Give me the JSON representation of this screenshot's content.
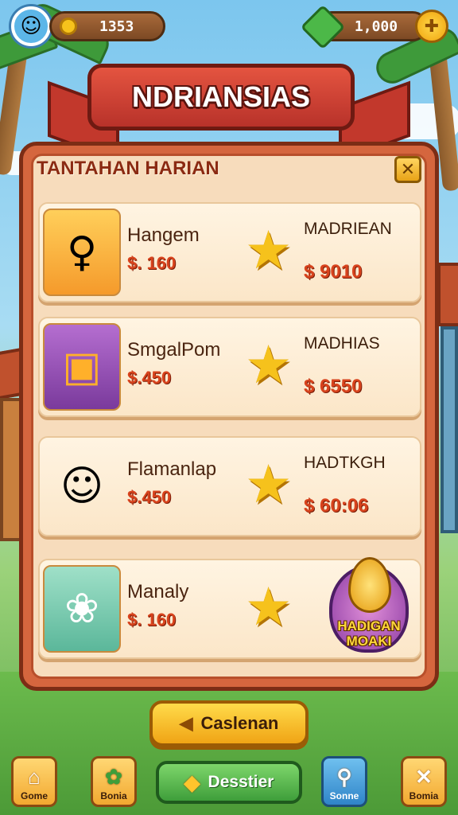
{
  "hud": {
    "coins": "1353",
    "gems": "1,000",
    "avatar_icon": "player-avatar-icon",
    "add_icon": "plus-icon"
  },
  "title": "NDRIANSIAS",
  "panel": {
    "header": "TANTAHAN HARIAN",
    "close_label": "✕"
  },
  "cards": [
    {
      "name": "Hangem",
      "price": "$. 160",
      "title": "MADRIEAN",
      "reward": "$ 9010",
      "icon": "girl-avatar-icon"
    },
    {
      "name": "SmgalPom",
      "price": "$.450",
      "title": "MADHIAS",
      "reward": "$ 6550",
      "icon": "fire-cube-icon"
    },
    {
      "name": "Flamanlap",
      "price": "$.450",
      "title": "HADTKGH",
      "reward": "$ 60:06",
      "icon": "boy-avatar-icon"
    },
    {
      "name": "Manaly",
      "price": "$. 160",
      "title": "",
      "reward": "",
      "icon": "dog-icon"
    }
  ],
  "badge": {
    "line1": "HADIGAN",
    "line2": "MOAKI"
  },
  "buttons": {
    "primary": "Caslenan",
    "green": "Desstier"
  },
  "tabs": [
    {
      "label": "Gome",
      "icon": "home-icon"
    },
    {
      "label": "Bonia",
      "icon": "gift-icon"
    },
    {
      "label": "Sonne",
      "icon": "search-icon"
    },
    {
      "label": "Bomia",
      "icon": "tools-icon"
    }
  ],
  "colors": {
    "panel": "#d5663e",
    "card": "#fff4e2",
    "price": "#d8431d",
    "ribbon": "#e45440",
    "primary_button": "#ffdb4a",
    "green_button": "#3e9e3a"
  }
}
